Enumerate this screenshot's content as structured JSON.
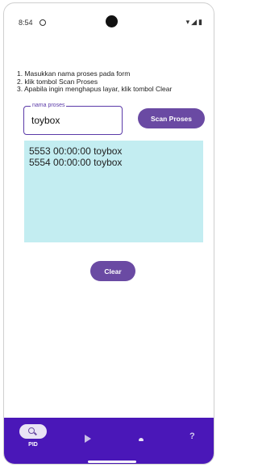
{
  "status_bar": {
    "time": "8:54",
    "icons": [
      "wifi-icon",
      "signal-icon",
      "battery-icon"
    ]
  },
  "instructions": [
    "1. Masukkan nama proses pada form",
    "2. klik tombol Scan Proses",
    "3. Apabila ingin menghapus layar, klik tombol Clear"
  ],
  "form": {
    "label": "nama proses",
    "value": "toybox"
  },
  "buttons": {
    "scan": "Scan Proses",
    "clear": "Clear"
  },
  "results": [
    "5553 00:00:00 toybox",
    "5554 00:00:00 toybox"
  ],
  "bottom_nav": {
    "items": [
      {
        "label": "PID",
        "icon": "search-icon",
        "selected": true
      },
      {
        "label": "",
        "icon": "play-icon",
        "selected": false
      },
      {
        "label": "",
        "icon": "cloud-icon",
        "selected": false
      },
      {
        "label": "",
        "icon": "help-icon",
        "selected": false
      }
    ],
    "help_glyph": "?"
  },
  "colors": {
    "accent": "#6a4aa3",
    "nav_background": "#4a17b8",
    "results_background": "#c3edf1"
  }
}
